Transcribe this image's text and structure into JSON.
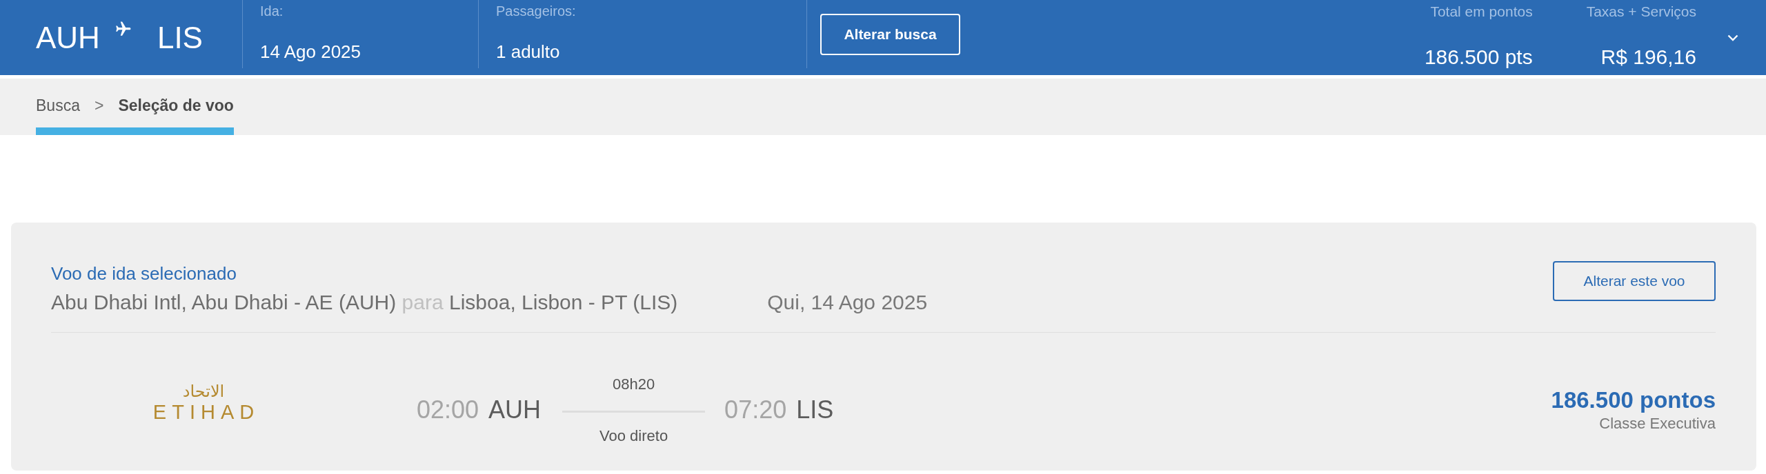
{
  "header": {
    "origin": "AUH",
    "destination": "LIS",
    "fields": [
      {
        "label": "Ida:",
        "value": "14 Ago 2025"
      },
      {
        "label": "Passageiros:",
        "value": "1 adulto"
      }
    ],
    "change_search_button": "Alterar busca",
    "totals": [
      {
        "label": "Total em pontos",
        "value": "186.500 pts"
      },
      {
        "label": "Taxas + Serviços",
        "value": "R$ 196,16"
      }
    ],
    "expanded": false
  },
  "breadcrumb": {
    "items": [
      {
        "label": "Busca",
        "selected": false
      },
      {
        "label": "Seleção de voo",
        "selected": true
      }
    ],
    "separator": ">"
  },
  "selected_flight": {
    "title": "Voo de ida selecionado",
    "origin": "Abu Dhabi Intl, Abu Dhabi - AE (AUH)",
    "connector": "para",
    "destination": "Lisboa, Lisbon - PT (LIS)",
    "date": "Qui, 14 Ago 2025",
    "change_button": "Alterar este voo",
    "flight": {
      "airline_logo": {
        "arabic": "الاتحاد",
        "latin": "ETIHAD"
      },
      "departure": {
        "time": "02:00",
        "airport": "AUH"
      },
      "duration": "08h20",
      "stops": "Voo direto",
      "arrival": {
        "time": "07:20",
        "airport": "LIS"
      },
      "price": "186.500 pontos",
      "cabin": "Classe Executiva"
    }
  }
}
